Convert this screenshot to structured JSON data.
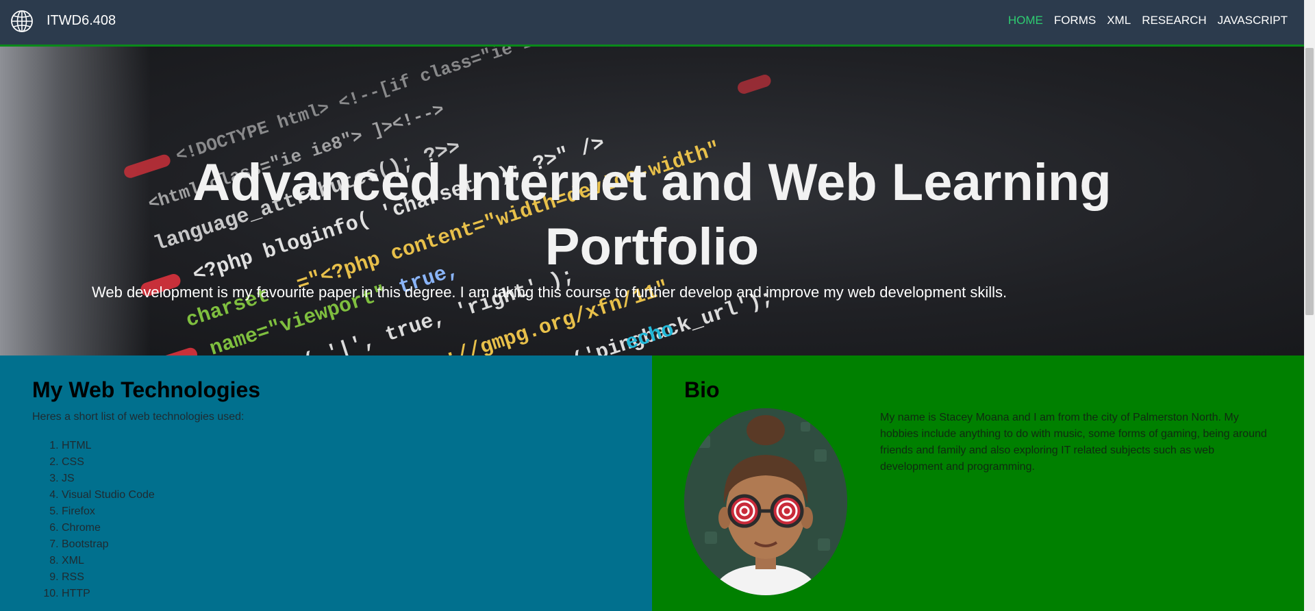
{
  "nav": {
    "brand": "ITWD6.408",
    "links": [
      "HOME",
      "FORMS",
      "XML",
      "RESEARCH",
      "JAVASCRIPT"
    ],
    "active": "HOME",
    "active_color": "#2ecc71"
  },
  "hero": {
    "title": "Advanced Internet and Web Learning Portfolio",
    "subtitle": "Web development is my favourite paper in this degree. I am taking this course to further develop and improve my web development skills."
  },
  "technologies": {
    "heading": "My Web Technologies",
    "intro": "Heres a short list of web technologies used:",
    "items": [
      "HTML",
      "CSS",
      "JS",
      "Visual Studio Code",
      "Firefox",
      "Chrome",
      "Bootstrap",
      "XML",
      "RSS",
      "HTTP"
    ],
    "bg_color": "#01708e"
  },
  "bio": {
    "heading": "Bio",
    "text": "My name is Stacey Moana and I am from the city of Palmerston North. My hobbies include anything to do with music, some forms of gaming, being around friends and family and also exploring IT related subjects such as web development and programming.",
    "bg_color": "#008000"
  }
}
